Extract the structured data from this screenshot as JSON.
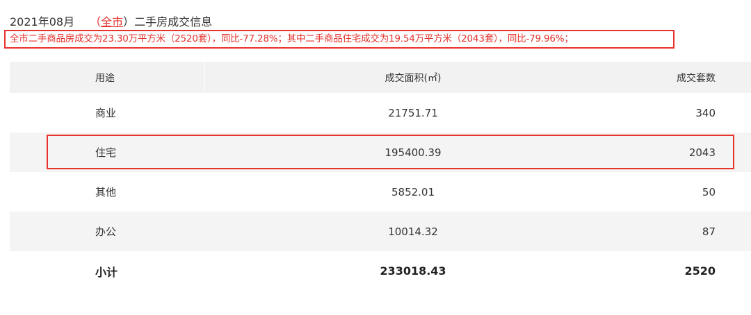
{
  "header": {
    "period": "2021年08月",
    "area_open": "（",
    "area": "全市",
    "area_close": "）",
    "title": "二手房成交信息"
  },
  "summary": "全市二手商品房成交为23.30万平方米（2520套），同比-77.28%；其中二手商品住宅成交为19.54万平方米（2043套），同比-79.96%；",
  "table": {
    "columns": [
      "用途",
      "成交面积(㎡)",
      "成交套数"
    ],
    "rows": [
      {
        "use": "商业",
        "area": "21751.71",
        "count": "340"
      },
      {
        "use": "住宅",
        "area": "195400.39",
        "count": "2043"
      },
      {
        "use": "其他",
        "area": "5852.01",
        "count": "50"
      },
      {
        "use": "办公",
        "area": "10014.32",
        "count": "87"
      }
    ],
    "total": {
      "use": "小计",
      "area": "233018.43",
      "count": "2520"
    }
  },
  "colors": {
    "accent": "#e5322d",
    "highlight_border": "#e8322c",
    "header_bg": "#f2f2f2",
    "stripe_bg": "#f4f4f4",
    "text": "#333333"
  }
}
